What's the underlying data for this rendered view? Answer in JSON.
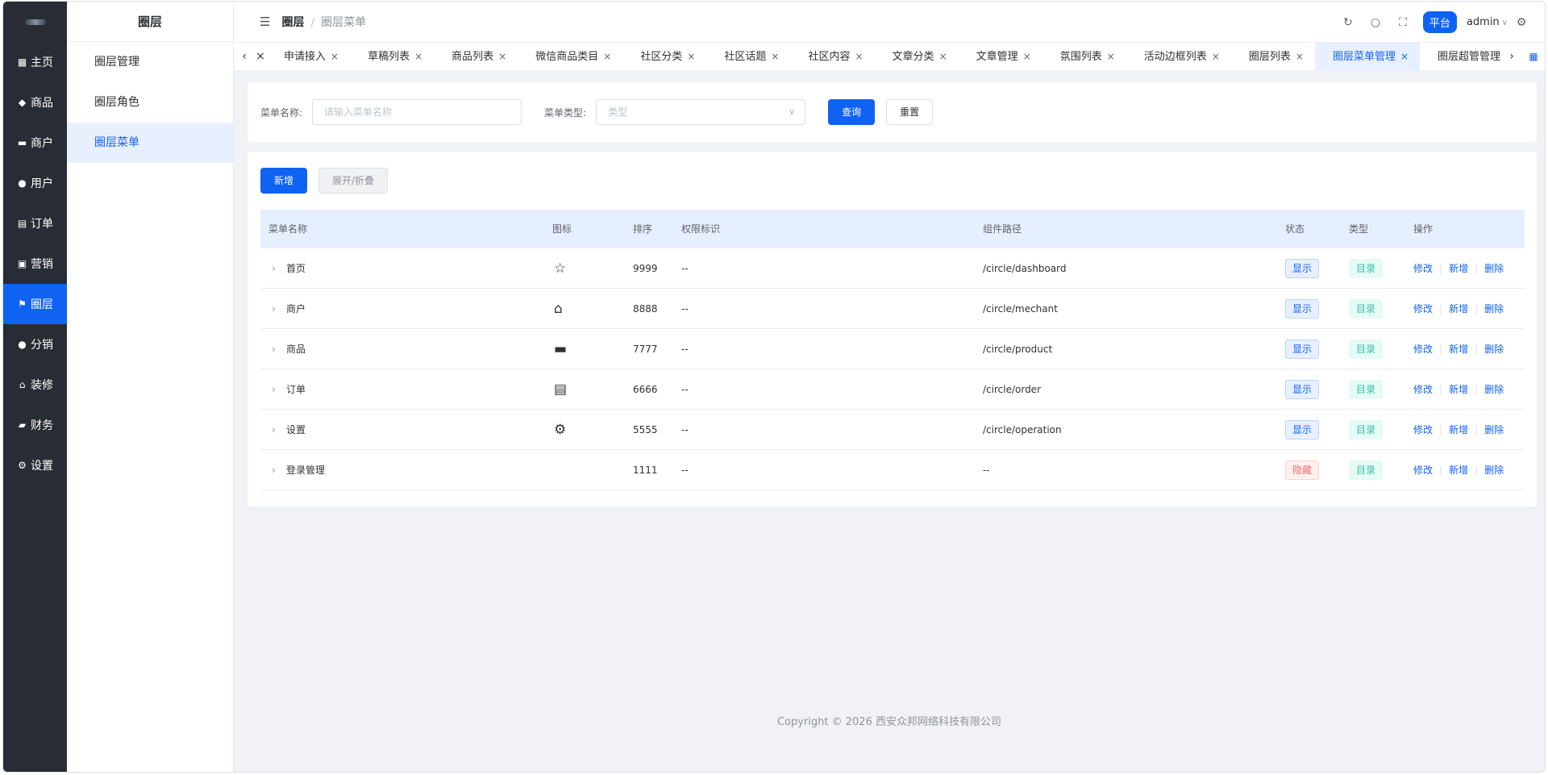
{
  "nav": {
    "items": [
      {
        "label": "主页",
        "icon": "grid-icon"
      },
      {
        "label": "商品",
        "icon": "bag-icon"
      },
      {
        "label": "商户",
        "icon": "store-icon"
      },
      {
        "label": "用户",
        "icon": "user-icon"
      },
      {
        "label": "订单",
        "icon": "clipboard-icon"
      },
      {
        "label": "营销",
        "icon": "chart-icon"
      },
      {
        "label": "圈层",
        "icon": "flag-icon"
      },
      {
        "label": "分销",
        "icon": "person-icon"
      },
      {
        "label": "装修",
        "icon": "home-icon"
      },
      {
        "label": "财务",
        "icon": "wallet-icon"
      },
      {
        "label": "设置",
        "icon": "gear-icon"
      }
    ],
    "active_index": 6
  },
  "sub": {
    "title": "圈层",
    "items": [
      "圈层管理",
      "圈层角色",
      "圈层菜单"
    ],
    "active_index": 2
  },
  "header": {
    "breadcrumb_root": "圈层",
    "breadcrumb_sep": "/",
    "breadcrumb_current": "圈层菜单",
    "platform_label": "平台",
    "user": "admin"
  },
  "tabs": [
    "申请接入",
    "草稿列表",
    "商品列表",
    "微信商品类目",
    "社区分类",
    "社区话题",
    "社区内容",
    "文章分类",
    "文章管理",
    "氛围列表",
    "活动边框列表",
    "圈层列表",
    "圈层菜单管理",
    "圈层超管管理"
  ],
  "active_tab": "圈层菜单管理",
  "search": {
    "name_label": "菜单名称:",
    "name_placeholder": "请输入菜单名称",
    "type_label": "菜单类型:",
    "type_placeholder": "类型",
    "query_btn": "查询",
    "reset_btn": "重置"
  },
  "toolbar": {
    "add_btn": "新增",
    "expand_btn": "展开/折叠"
  },
  "table": {
    "columns": [
      "菜单名称",
      "图标",
      "排序",
      "权限标识",
      "组件路径",
      "状态",
      "类型",
      "操作"
    ],
    "rows": [
      {
        "name": "首页",
        "icon": "star-icon",
        "glyph": "☆",
        "sort": "9999",
        "perm": "--",
        "path": "/circle/dashboard",
        "status": "显示",
        "status_kind": "show",
        "type": "目录"
      },
      {
        "name": "商户",
        "icon": "house-icon",
        "glyph": "⌂",
        "sort": "8888",
        "perm": "--",
        "path": "/circle/mechant",
        "status": "显示",
        "status_kind": "show",
        "type": "目录"
      },
      {
        "name": "商品",
        "icon": "briefcase-icon",
        "glyph": "▬",
        "sort": "7777",
        "perm": "--",
        "path": "/circle/product",
        "status": "显示",
        "status_kind": "show",
        "type": "目录"
      },
      {
        "name": "订单",
        "icon": "clipboard-icon",
        "glyph": "▤",
        "sort": "6666",
        "perm": "--",
        "path": "/circle/order",
        "status": "显示",
        "status_kind": "show",
        "type": "目录"
      },
      {
        "name": "设置",
        "icon": "gear-icon",
        "glyph": "⚙",
        "sort": "5555",
        "perm": "--",
        "path": "/circle/operation",
        "status": "显示",
        "status_kind": "show",
        "type": "目录"
      },
      {
        "name": "登录管理",
        "icon": "",
        "glyph": "",
        "sort": "1111",
        "perm": "--",
        "path": "--",
        "status": "隐藏",
        "status_kind": "hide",
        "type": "目录"
      }
    ],
    "ops": [
      "修改",
      "新增",
      "删除"
    ]
  },
  "footer": "Copyright © 2026 西安众邦网络科技有限公司",
  "colors": {
    "primary": "#1062f3",
    "nav_bg": "#282c34",
    "danger": "#f56c6c",
    "teal": "#38c0a4"
  }
}
